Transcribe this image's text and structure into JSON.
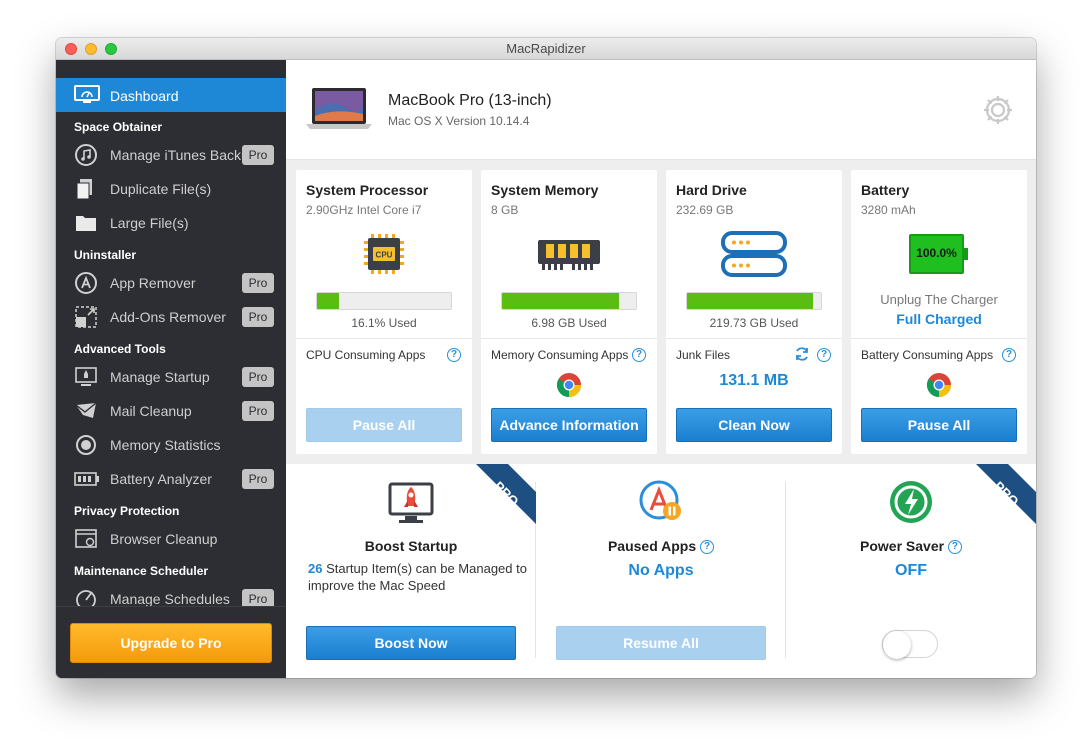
{
  "app": {
    "title": "MacRapidizer"
  },
  "sidebar": {
    "active": {
      "label": "Dashboard",
      "icon": "monitor-icon"
    },
    "sections": [
      {
        "title": "Space Obtainer",
        "items": [
          {
            "label": "Manage iTunes Backup",
            "icon": "music-note-icon",
            "pro": "Pro"
          },
          {
            "label": "Duplicate File(s)",
            "icon": "duplicate-file-icon",
            "pro": ""
          },
          {
            "label": "Large File(s)",
            "icon": "folder-icon",
            "pro": ""
          }
        ]
      },
      {
        "title": "Uninstaller",
        "items": [
          {
            "label": "App Remover",
            "icon": "app-store-icon",
            "pro": "Pro"
          },
          {
            "label": "Add-Ons Remover",
            "icon": "addon-icon",
            "pro": "Pro"
          }
        ]
      },
      {
        "title": "Advanced Tools",
        "items": [
          {
            "label": "Manage Startup",
            "icon": "startup-icon",
            "pro": "Pro"
          },
          {
            "label": "Mail Cleanup",
            "icon": "mail-icon",
            "pro": "Pro"
          },
          {
            "label": "Memory Statistics",
            "icon": "memory-icon",
            "pro": ""
          },
          {
            "label": "Battery Analyzer",
            "icon": "battery-icon",
            "pro": "Pro"
          }
        ]
      },
      {
        "title": "Privacy Protection",
        "items": [
          {
            "label": "Browser Cleanup",
            "icon": "browser-icon",
            "pro": ""
          }
        ]
      },
      {
        "title": "Maintenance Scheduler",
        "items": [
          {
            "label": "Manage Schedules",
            "icon": "schedule-icon",
            "pro": "Pro"
          }
        ]
      }
    ],
    "upgrade_label": "Upgrade to Pro"
  },
  "header": {
    "model": "MacBook Pro (13-inch)",
    "os": "Mac OS X Version 10.14.4"
  },
  "cards": {
    "cpu": {
      "title": "System Processor",
      "sub": "2.90GHz Intel Core i7",
      "used": "16.1% Used",
      "progress": 0.161,
      "apps_label": "CPU Consuming Apps",
      "button": "Pause All",
      "chip_text": "CPU"
    },
    "memory": {
      "title": "System Memory",
      "sub": "8 GB",
      "used": "6.98 GB Used",
      "progress": 0.87,
      "apps_label": "Memory Consuming Apps",
      "button": "Advance Information"
    },
    "disk": {
      "title": "Hard Drive",
      "sub": "232.69 GB",
      "used": "219.73 GB Used",
      "progress": 0.94,
      "apps_label": "Junk Files",
      "junk_size": "131.1 MB",
      "button": "Clean Now"
    },
    "battery": {
      "title": "Battery",
      "sub": "3280 mAh",
      "level": "100.0%",
      "hint": "Unplug The Charger",
      "status": "Full Charged",
      "apps_label": "Battery Consuming Apps",
      "button": "Pause All"
    }
  },
  "panels": {
    "boost": {
      "title": "Boost Startup",
      "count": "26",
      "desc": " Startup Item(s) can be Managed to improve the Mac Speed",
      "button": "Boost Now",
      "ribbon": "PRO"
    },
    "paused": {
      "title": "Paused Apps",
      "value": "No Apps",
      "button": "Resume All"
    },
    "power": {
      "title": "Power Saver",
      "value": "OFF",
      "ribbon": "PRO"
    }
  },
  "colors": {
    "accent": "#1e88d6",
    "progress": "#5bbd12",
    "sidebar": "#2d2e33",
    "upgrade": "#f7a51a",
    "ribbon": "#1d4f82"
  }
}
